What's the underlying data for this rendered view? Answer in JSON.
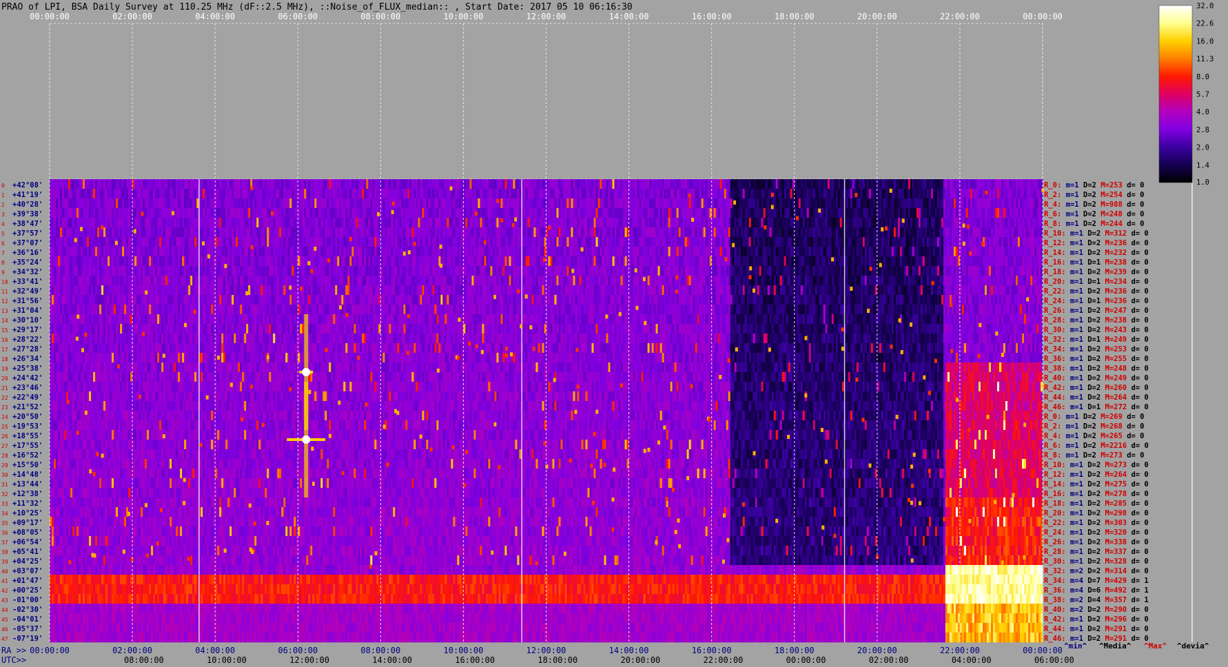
{
  "title": "PRAO of LPI, BSA Daily Survey at 110.25 MHz (dF::2.5 MHz), ::Noise_of_FLUX_median:: , Start Date: 2017 05 10 06:16:30",
  "chart_data": {
    "type": "heatmap",
    "title": "PRAO of LPI, BSA Daily Survey at 110.25 MHz (dF::2.5 MHz), ::Noise_of_FLUX_median:: , Start Date: 2017 05 10 06:16:30",
    "top_axis_ticks": [
      "00:00:00",
      "02:00:00",
      "04:00:00",
      "06:00:00",
      "08:00:00",
      "10:00:00",
      "12:00:00",
      "14:00:00",
      "16:00:00",
      "18:00:00",
      "20:00:00",
      "22:00:00",
      "00:00:00"
    ],
    "ra_axis_label": "RA >>",
    "ra_ticks": [
      "00:00:00",
      "02:00:00",
      "04:00:00",
      "06:00:00",
      "08:00:00",
      "10:00:00",
      "12:00:00",
      "14:00:00",
      "16:00:00",
      "18:00:00",
      "20:00:00",
      "22:00:00",
      "00:00:00"
    ],
    "utc_axis_label": "UTC>>",
    "utc_ticks": [
      "08:00:00",
      "10:00:00",
      "12:00:00",
      "14:00:00",
      "16:00:00",
      "18:00:00",
      "20:00:00",
      "22:00:00",
      "00:00:00",
      "02:00:00",
      "04:00:00",
      "06:00:00"
    ],
    "declinations": [
      "+42°08'",
      "+41°19'",
      "+40°28'",
      "+39°38'",
      "+38°47'",
      "+37°57'",
      "+37°07'",
      "+36°16'",
      "+35°24'",
      "+34°32'",
      "+33°41'",
      "+32°49'",
      "+31°56'",
      "+31°04'",
      "+30°10'",
      "+29°17'",
      "+28°22'",
      "+27°28'",
      "+26°34'",
      "+25°38'",
      "+24°42'",
      "+23°46'",
      "+22°49'",
      "+21°52'",
      "+20°50'",
      "+19°53'",
      "+18°55'",
      "+17°55'",
      "+16°52'",
      "+15°50'",
      "+14°48'",
      "+13°44'",
      "+12°38'",
      "+11°32'",
      "+10°25'",
      "+09°17'",
      "+08°05'",
      "+06°54'",
      "+05°41'",
      "+04°25'",
      "+03°07'",
      "+01°47'",
      "+00°25'",
      "-01°00'",
      "-02°30'",
      "-04°01'",
      "-05°37'",
      "-07°19'"
    ],
    "colorbar": {
      "ticks": [
        "32.0",
        "22.6",
        "16.0",
        "11.3",
        "8.0",
        "5.7",
        "4.0",
        "2.8",
        "2.0",
        "1.4",
        "1.0"
      ],
      "colors": [
        "#ffffff",
        "#ffff90",
        "#ffd000",
        "#ff8000",
        "#ff1a00",
        "#e00060",
        "#b000c0",
        "#8000e0",
        "#3a00a0",
        "#150050",
        "#000000"
      ]
    },
    "row_stats": [
      {
        "r": "R_0:",
        "m": "1",
        "d": "2",
        "M": "253",
        "dv": "0"
      },
      {
        "r": "R_2:",
        "m": "1",
        "d": "2",
        "M": "254",
        "dv": "0"
      },
      {
        "r": "R_4:",
        "m": "1",
        "d": "2",
        "M": "988",
        "dv": "0"
      },
      {
        "r": "R_6:",
        "m": "1",
        "d": "2",
        "M": "248",
        "dv": "0"
      },
      {
        "r": "R_8:",
        "m": "1",
        "d": "2",
        "M": "244",
        "dv": "0"
      },
      {
        "r": "R_10:",
        "m": "1",
        "d": "2",
        "M": "312",
        "dv": "0"
      },
      {
        "r": "R_12:",
        "m": "1",
        "d": "2",
        "M": "236",
        "dv": "0"
      },
      {
        "r": "R_14:",
        "m": "1",
        "d": "2",
        "M": "232",
        "dv": "0"
      },
      {
        "r": "R_16:",
        "m": "1",
        "d": "1",
        "M": "238",
        "dv": "0"
      },
      {
        "r": "R_18:",
        "m": "1",
        "d": "2",
        "M": "239",
        "dv": "0"
      },
      {
        "r": "R_20:",
        "m": "1",
        "d": "1",
        "M": "234",
        "dv": "0"
      },
      {
        "r": "R_22:",
        "m": "1",
        "d": "2",
        "M": "236",
        "dv": "0"
      },
      {
        "r": "R_24:",
        "m": "1",
        "d": "1",
        "M": "236",
        "dv": "0"
      },
      {
        "r": "R_26:",
        "m": "1",
        "d": "2",
        "M": "247",
        "dv": "0"
      },
      {
        "r": "R_28:",
        "m": "1",
        "d": "2",
        "M": "238",
        "dv": "0"
      },
      {
        "r": "R_30:",
        "m": "1",
        "d": "2",
        "M": "243",
        "dv": "0"
      },
      {
        "r": "R_32:",
        "m": "1",
        "d": "1",
        "M": "249",
        "dv": "0"
      },
      {
        "r": "R_34:",
        "m": "1",
        "d": "2",
        "M": "253",
        "dv": "0"
      },
      {
        "r": "R_36:",
        "m": "1",
        "d": "2",
        "M": "255",
        "dv": "0"
      },
      {
        "r": "R_38:",
        "m": "1",
        "d": "2",
        "M": "248",
        "dv": "0"
      },
      {
        "r": "R_40:",
        "m": "1",
        "d": "2",
        "M": "249",
        "dv": "0"
      },
      {
        "r": "R_42:",
        "m": "1",
        "d": "2",
        "M": "260",
        "dv": "0"
      },
      {
        "r": "R_44:",
        "m": "1",
        "d": "2",
        "M": "264",
        "dv": "0"
      },
      {
        "r": "R_46:",
        "m": "1",
        "d": "1",
        "M": "272",
        "dv": "0"
      },
      {
        "r": "R_0:",
        "m": "1",
        "d": "2",
        "M": "269",
        "dv": "0"
      },
      {
        "r": "R_2:",
        "m": "1",
        "d": "2",
        "M": "268",
        "dv": "0"
      },
      {
        "r": "R_4:",
        "m": "1",
        "d": "2",
        "M": "265",
        "dv": "0"
      },
      {
        "r": "R_6:",
        "m": "1",
        "d": "2",
        "M": "2216",
        "dv": "0"
      },
      {
        "r": "R_8:",
        "m": "1",
        "d": "2",
        "M": "273",
        "dv": "0"
      },
      {
        "r": "R_10:",
        "m": "1",
        "d": "2",
        "M": "273",
        "dv": "0"
      },
      {
        "r": "R_12:",
        "m": "1",
        "d": "2",
        "M": "264",
        "dv": "0"
      },
      {
        "r": "R_14:",
        "m": "1",
        "d": "2",
        "M": "275",
        "dv": "0"
      },
      {
        "r": "R_16:",
        "m": "1",
        "d": "2",
        "M": "278",
        "dv": "0"
      },
      {
        "r": "R_18:",
        "m": "1",
        "d": "2",
        "M": "285",
        "dv": "0"
      },
      {
        "r": "R_20:",
        "m": "1",
        "d": "2",
        "M": "298",
        "dv": "0"
      },
      {
        "r": "R_22:",
        "m": "1",
        "d": "2",
        "M": "303",
        "dv": "0"
      },
      {
        "r": "R_24:",
        "m": "1",
        "d": "2",
        "M": "320",
        "dv": "0"
      },
      {
        "r": "R_26:",
        "m": "1",
        "d": "2",
        "M": "338",
        "dv": "0"
      },
      {
        "r": "R_28:",
        "m": "1",
        "d": "2",
        "M": "337",
        "dv": "0"
      },
      {
        "r": "R_30:",
        "m": "1",
        "d": "2",
        "M": "328",
        "dv": "0"
      },
      {
        "r": "R_32:",
        "m": "2",
        "d": "2",
        "M": "314",
        "dv": "0"
      },
      {
        "r": "R_34:",
        "m": "4",
        "d": "7",
        "M": "429",
        "dv": "1"
      },
      {
        "r": "R_36:",
        "m": "4",
        "d": "6",
        "M": "492",
        "dv": "1"
      },
      {
        "r": "R_38:",
        "m": "2",
        "d": "4",
        "M": "357",
        "dv": "1"
      },
      {
        "r": "R_40:",
        "m": "2",
        "d": "2",
        "M": "290",
        "dv": "0"
      },
      {
        "r": "R_42:",
        "m": "1",
        "d": "2",
        "M": "296",
        "dv": "0"
      },
      {
        "r": "R_44:",
        "m": "1",
        "d": "2",
        "M": "291",
        "dv": "0"
      },
      {
        "r": "R_46:",
        "m": "1",
        "d": "2",
        "M": "291",
        "dv": "0"
      }
    ],
    "stats_prefix": {
      "m": "m=",
      "d": "D=",
      "M": "M=",
      "dv": "d="
    },
    "legend": {
      "min": "^min^",
      "median": "^Media^",
      "max": "^Max^",
      "devia": "^devia^"
    }
  }
}
